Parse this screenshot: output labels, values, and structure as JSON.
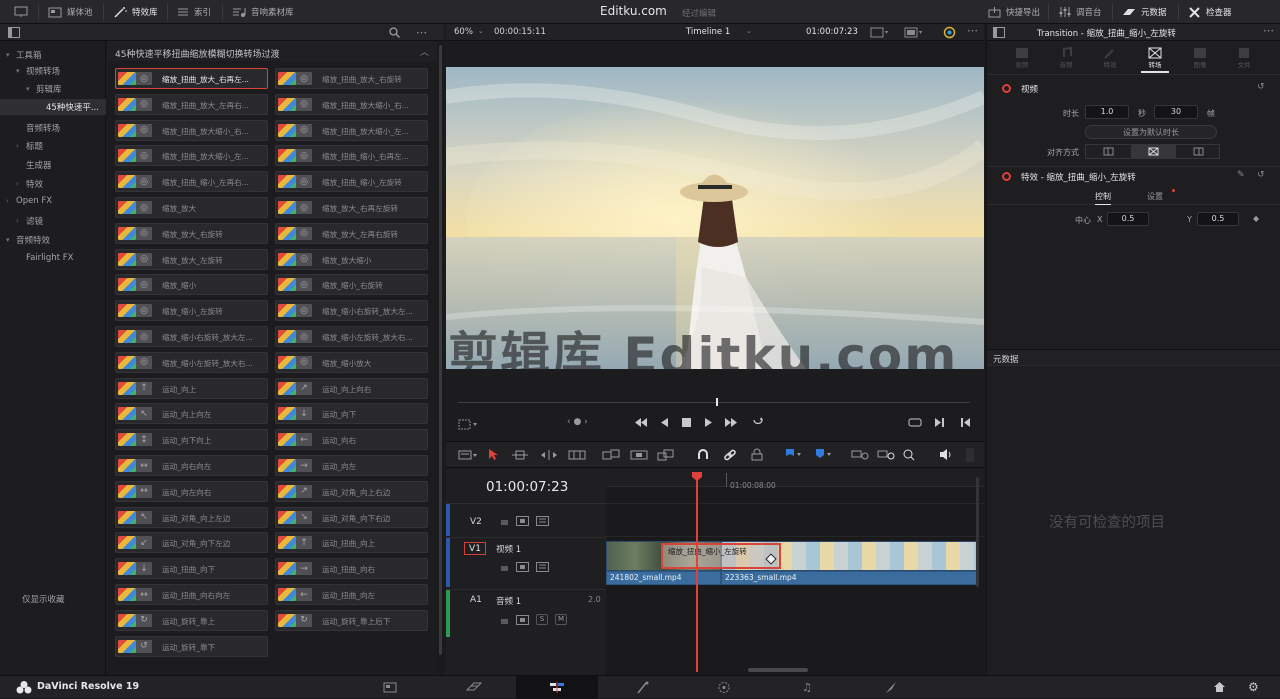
{
  "topbar": {
    "media_pool": "媒体池",
    "effects": "特效库",
    "index": "索引",
    "sound_library": "音响素材库",
    "title": "Editku.com",
    "subtitle": "经过编辑",
    "quick_export": "快捷导出",
    "mixer": "调音台",
    "metadata": "元数据",
    "inspector": "检查器"
  },
  "sidebar": {
    "items": [
      {
        "label": "工具箱",
        "indent": 0,
        "caret": "▾"
      },
      {
        "label": "视频转场",
        "indent": 1,
        "caret": "▾"
      },
      {
        "label": "剪辑库",
        "indent": 2,
        "caret": "▾"
      },
      {
        "label": "45种快速平...",
        "indent": 3,
        "caret": ""
      },
      {
        "label": "音频转场",
        "indent": 1,
        "caret": ""
      },
      {
        "label": "标题",
        "indent": 1,
        "caret": "›"
      },
      {
        "label": "生成器",
        "indent": 1,
        "caret": ""
      },
      {
        "label": "特效",
        "indent": 1,
        "caret": "›"
      },
      {
        "label": "Open FX",
        "indent": 0,
        "caret": "›"
      },
      {
        "label": "滤镜",
        "indent": 1,
        "caret": "›"
      },
      {
        "label": "音频特效",
        "indent": 0,
        "caret": "▾"
      },
      {
        "label": "Fairlight FX",
        "indent": 1,
        "caret": ""
      }
    ],
    "favorites": "仅显示收藏"
  },
  "effects_panel": {
    "title": "45种快速平移扭曲缩放模糊切换转场过渡",
    "tiles": [
      "缩放_扭曲_放大_右再左...",
      "缩放_扭曲_放大_右旋转",
      "缩放_扭曲_放大_左再右...",
      "缩放_扭曲_放大缩小_右...",
      "缩放_扭曲_放大缩小_右...",
      "缩放_扭曲_放大缩小_左...",
      "缩放_扭曲_放大缩小_左...",
      "缩放_扭曲_缩小_右再左...",
      "缩放_扭曲_缩小_左再右...",
      "缩放_扭曲_缩小_左旋转",
      "缩放_放大",
      "缩放_放大_右再左旋转",
      "缩放_放大_右旋转",
      "缩放_放大_左再右旋转",
      "缩放_放大_左旋转",
      "缩放_放大缩小",
      "缩放_缩小",
      "缩放_缩小_右旋转",
      "缩放_缩小_左旋转",
      "缩放_缩小右旋转_放大左...",
      "缩放_缩小右旋转_放大左...",
      "缩放_缩小左旋转_放大右...",
      "缩放_缩小左旋转_放大右...",
      "缩放_缩小放大",
      "运动_向上",
      "运动_向上向右",
      "运动_向上向左",
      "运动_向下",
      "运动_向下向上",
      "运动_向右",
      "运动_向右向左",
      "运动_向左",
      "运动_向左向右",
      "运动_对角_向上右边",
      "运动_对角_向上左边",
      "运动_对角_向下右边",
      "运动_对角_向下左边",
      "运动_扭曲_向上",
      "运动_扭曲_向下",
      "运动_扭曲_向右",
      "运动_扭曲_向右向左",
      "运动_扭曲_向左",
      "运动_旋转_靠上",
      "运动_旋转_靠上后下",
      "运动_旋转_靠下"
    ]
  },
  "viewer": {
    "zoom": "60%",
    "duration": "00:00:15:11",
    "timeline_name": "Timeline 1",
    "timecode": "01:00:07:23",
    "watermark": "剪辑库 Editku.com"
  },
  "timeline": {
    "timecode": "01:00:07:23",
    "ruler_mark": "01:00:08:00",
    "tracks": [
      {
        "id": "V2",
        "name": ""
      },
      {
        "id": "V1",
        "name": "视频 1"
      },
      {
        "id": "A1",
        "name": "音频 1",
        "level": "2.0"
      }
    ],
    "clips": {
      "clip_a": "241802_small.mp4",
      "clip_b": "223363_small.mp4",
      "transition": "缩放_扭曲_缩小_左旋转"
    }
  },
  "inspector": {
    "title": "Transition - 缩放_扭曲_缩小_左旋转",
    "tabs": [
      "视频",
      "音频",
      "特效",
      "转场",
      "图像",
      "文件"
    ],
    "active_tab": "转场",
    "video_section": "视频",
    "duration_label": "时长",
    "duration_value": "1.0",
    "seconds_label": "秒",
    "frames_value": "30",
    "frames_label": "帧",
    "set_default": "设置为默认时长",
    "alignment_label": "对齐方式",
    "effect_section": "特效 - 缩放_扭曲_缩小_左旋转",
    "subtabs": [
      "控制",
      "设置"
    ],
    "center_label": "中心",
    "x_label": "X",
    "x_value": "0.5",
    "y_label": "Y",
    "y_value": "0.5",
    "metadata_title": "元数据",
    "no_items": "没有可检查的项目"
  },
  "bottombar": {
    "app_name": "DaVinci Resolve 19"
  }
}
